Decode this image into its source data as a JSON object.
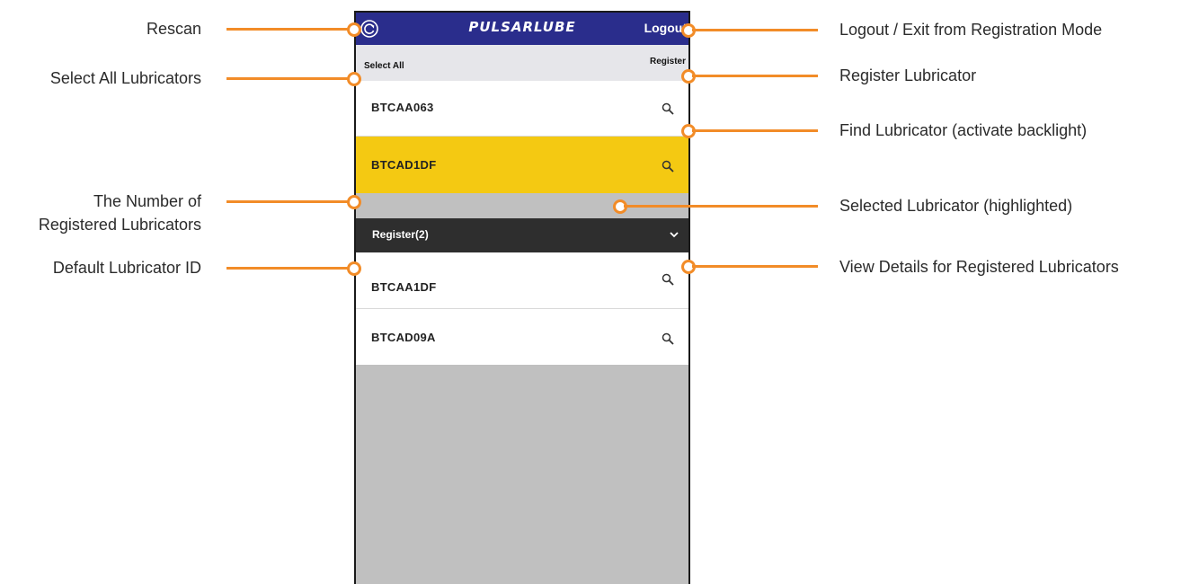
{
  "app": {
    "brand": "PULSARLUBE",
    "logout_label": "Logout",
    "select_all_label": "Select All",
    "register_label": "Register",
    "rescan_icon": "refresh-icon",
    "search_icon": "magnifier-icon"
  },
  "unregistered": [
    {
      "id": "BTCAA063",
      "selected": false
    },
    {
      "id": "BTCAD1DF",
      "selected": true
    }
  ],
  "registered_section": {
    "label": "Register(2)"
  },
  "registered": [
    {
      "id": "BTCAA1DF"
    },
    {
      "id": "BTCAD09A"
    }
  ],
  "annotations": {
    "rescan": "Rescan",
    "select_all": "Select All Lubricators",
    "registered_count_line1": "The Number of",
    "registered_count_line2": "Registered Lubricators",
    "default_id": "Default Lubricator ID",
    "logout": "Logout / Exit from Registration Mode",
    "register": "Register Lubricator",
    "find": "Find Lubricator (activate backlight)",
    "selected": "Selected Lubricator (highlighted)",
    "view_details": "View Details for Registered Lubricators"
  },
  "colors": {
    "header": "#2a2d8c",
    "selected_row": "#f4c912",
    "section_bar": "#2e2e2e",
    "accent": "#f28c28",
    "empty_area": "#c0c0c0"
  }
}
